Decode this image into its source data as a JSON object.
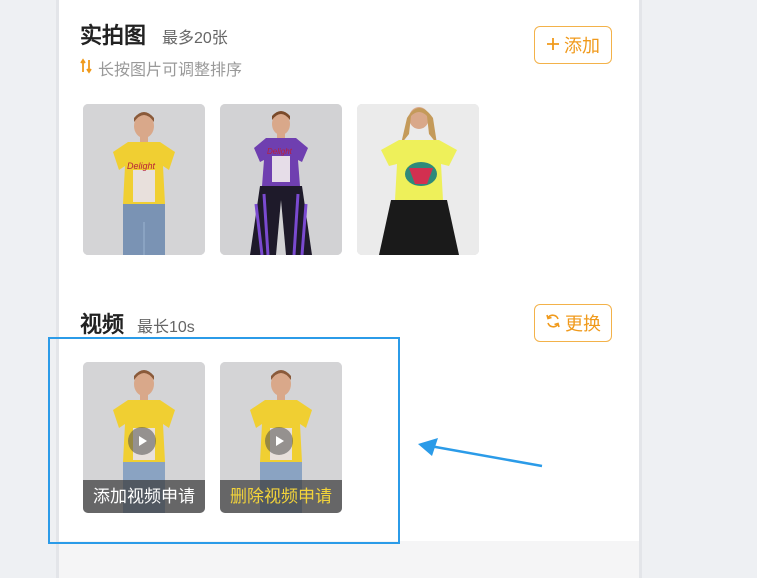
{
  "photos": {
    "title": "实拍图",
    "limit": "最多20张",
    "sort_hint": "长按图片可调整排序",
    "add_button": "添加"
  },
  "video": {
    "title": "视频",
    "limit": "最长10s",
    "replace_button": "更换",
    "items": [
      {
        "label": "添加视频申请"
      },
      {
        "label": "删除视频申请"
      }
    ]
  },
  "colors": {
    "accent": "#f09a1c",
    "highlight": "#2b9be8",
    "delete_label": "#f2d33a",
    "add_label": "#ffffff"
  }
}
